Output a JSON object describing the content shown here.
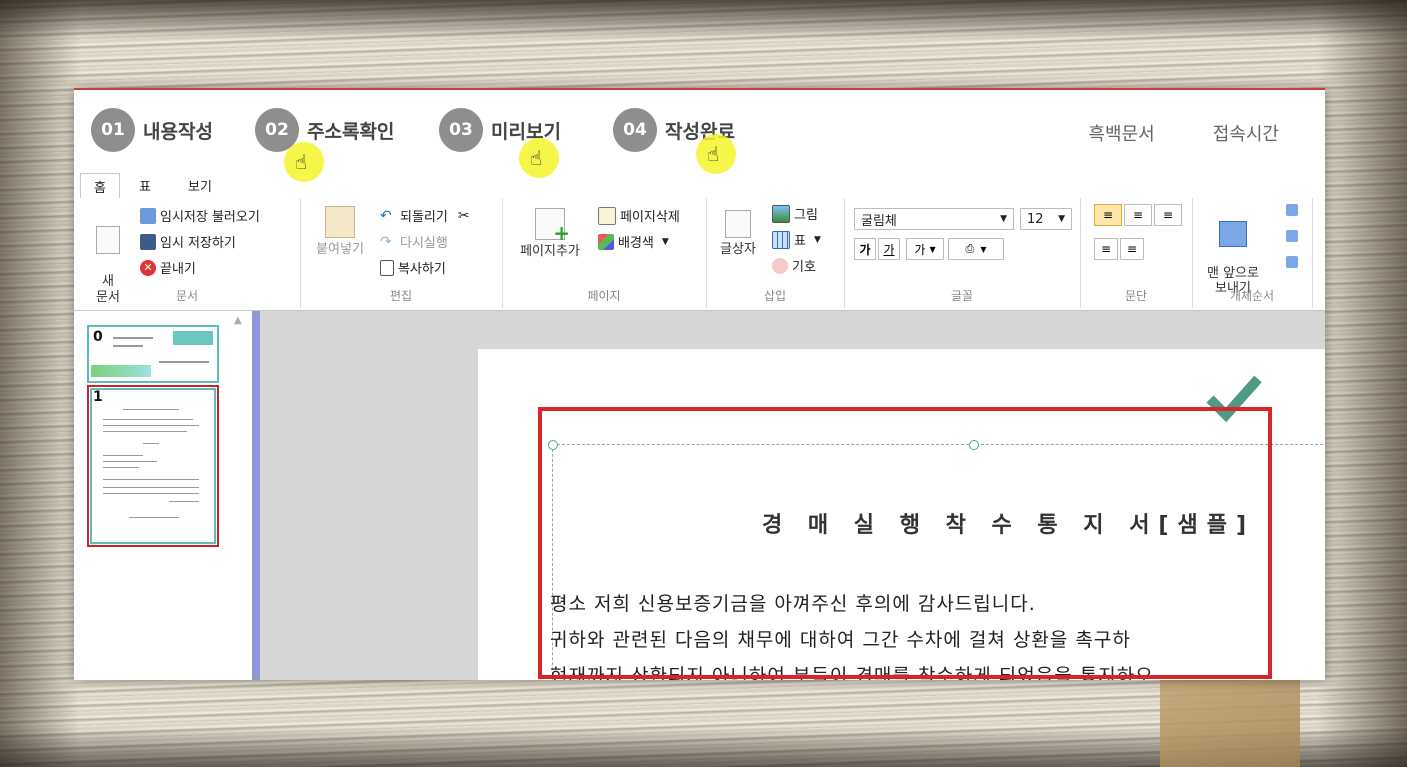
{
  "steps": [
    {
      "num": "01",
      "label": "내용작성"
    },
    {
      "num": "02",
      "label": "주소록확인"
    },
    {
      "num": "03",
      "label": "미리보기"
    },
    {
      "num": "04",
      "label": "작성완료"
    }
  ],
  "top_links": [
    "흑백문서",
    "접속시간"
  ],
  "tabs": [
    "홈",
    "표",
    "보기"
  ],
  "ribbon": {
    "doc": {
      "title": "문서",
      "new": "새\n문서",
      "temp_load": "임시저장 불러오기",
      "temp_save": "임시 저장하기",
      "exit": "끝내기"
    },
    "edit": {
      "title": "편집",
      "paste": "붙여넣기",
      "undo": "되돌리기",
      "redo": "다시실행",
      "copy": "복사하기"
    },
    "page": {
      "title": "페이지",
      "add": "페이지추가",
      "delete": "페이지삭제",
      "bgcolor": "배경색"
    },
    "insert": {
      "title": "삽입",
      "textbox": "글상자",
      "image": "그림",
      "table": "표",
      "symbol": "기호"
    },
    "font": {
      "title": "글꼴",
      "family": "굴림체",
      "size": "12",
      "bold": "가",
      "underline": "가",
      "color": "가"
    },
    "para": {
      "title": "문단"
    },
    "order": {
      "title": "개체순서",
      "front": "맨 앞으로\n보내기"
    }
  },
  "thumbnails": [
    {
      "num": "0"
    },
    {
      "num": "1"
    }
  ],
  "document": {
    "title": "경 매 실 행 착 수 통 지 서[샘플]",
    "line1": "평소 저희 신용보증기금을 아껴주신 후의에 감사드립니다.",
    "line2": "귀하와 관련된 다음의 채무에 대하여 그간 수차에 걸쳐 상환을 촉구하",
    "line3": "현재까지 상환되지 아니하여 부득이 경매를 착수하게 되었음을 통지하오"
  },
  "colors": {
    "accent_red": "#d8252c",
    "check_green": "#4e9a86",
    "step_gray": "#8e8e8e"
  }
}
